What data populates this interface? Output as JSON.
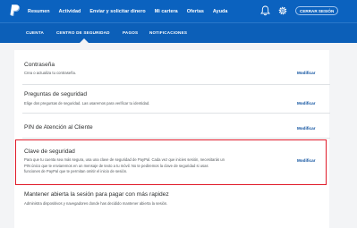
{
  "nav": {
    "links": [
      "Resumen",
      "Actividad",
      "Enviar y solicitar dinero",
      "Mi cartera",
      "Ofertas",
      "Ayuda"
    ],
    "logout_label": "CERRAR SESIÓN",
    "bell_icon": "bell-icon",
    "gear_icon": "gear-icon",
    "brand_color": "#0b62bf"
  },
  "subnav": {
    "tabs": [
      "CUENTA",
      "CENTRO DE SEGURIDAD",
      "PAGOS",
      "NOTIFICACIONES"
    ],
    "active_tab": "CENTRO DE SEGURIDAD"
  },
  "security": {
    "modify_label": "Modificar",
    "items": [
      {
        "title": "Contraseña",
        "desc": [
          "Crea o actualiza tu contraseña."
        ],
        "has_modify": true
      },
      {
        "title": "Preguntas de seguridad",
        "desc": [
          "Elige dos preguntas de seguridad. Las usaremos para verificar tu identidad."
        ],
        "has_modify": true
      },
      {
        "title": "PIN de Atención al Cliente",
        "desc": [],
        "has_modify": true
      },
      {
        "title": "Clave de seguridad",
        "desc": [
          "Para que tu cuenta sea más segura, usa una clave de seguridad de PayPal. Cada vez que inicies sesión, necesitarás un",
          "PIN único que te enviaremos en un mensaje de texto a tu móvil. No te pediremos la clave de seguridad si usas",
          "funciones de PayPal que te permitan omitir el inicio de sesión."
        ],
        "has_modify": true,
        "highlighted": true
      },
      {
        "title": "Mantener abierta la sesión para pagar con más rapidez",
        "desc": [
          "Administra dispositivos y navegadores donde has decidido mantener abierta la sesión."
        ],
        "has_modify": false
      }
    ],
    "highlight_color": "#e01b2a"
  }
}
